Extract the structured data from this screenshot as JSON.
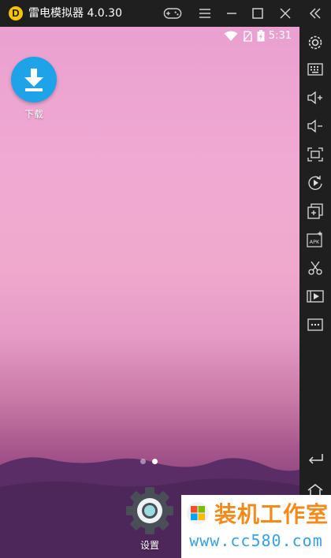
{
  "window": {
    "title": "雷电模拟器 4.0.30",
    "logo_letter": "D",
    "controls": [
      "gamepad-icon",
      "menu-icon",
      "minimize-icon",
      "maximize-icon",
      "close-icon",
      "collapse-sidebar-icon"
    ]
  },
  "status_bar": {
    "time": "5:31",
    "icons": [
      "wifi-icon",
      "no-sim-icon",
      "battery-charging-icon"
    ]
  },
  "home": {
    "apps": [
      {
        "label": "下载",
        "icon": "download-icon",
        "color": "#1ea3e8"
      },
      {
        "label": "设置",
        "icon": "settings-icon",
        "color": "#4a4f57"
      }
    ],
    "page_count": 2,
    "active_page": 2
  },
  "sidebar": {
    "buttons": [
      "settings-gear-icon",
      "keyboard-icon",
      "volume-up-icon",
      "volume-down-icon",
      "fullscreen-icon",
      "rotate-icon",
      "add-app-icon",
      "install-apk-icon",
      "scissors-icon",
      "video-record-icon",
      "more-icon",
      "back-icon",
      "home-icon"
    ],
    "apk_text": "APK"
  },
  "watermark": {
    "title": "装机工作室",
    "url": "www.cc580.com",
    "colors": {
      "title": "#f28a1c",
      "url": "#3aa0e0"
    }
  },
  "colors": {
    "window_chrome": "#1f1f1f",
    "accent_download": "#1ea3e8"
  }
}
